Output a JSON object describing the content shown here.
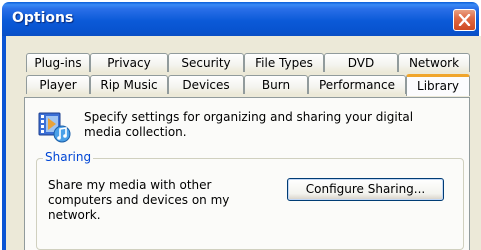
{
  "window": {
    "title": "Options",
    "close_icon": "close-icon"
  },
  "tabs": {
    "row_top": [
      "Plug-ins",
      "Privacy",
      "Security",
      "File Types",
      "DVD",
      "Network"
    ],
    "row_bottom": [
      "Player",
      "Rip Music",
      "Devices",
      "Burn",
      "Performance",
      "Library"
    ],
    "active": "Library"
  },
  "library": {
    "icon": "media-library-icon",
    "description": "Specify settings for organizing and sharing your digital media collection.",
    "sharing": {
      "group_label": "Sharing",
      "text": "Share my media with other computers and devices on my network.",
      "button_label": "Configure Sharing..."
    }
  },
  "colors": {
    "titlebar": "#0a5ed9",
    "close_button": "#e06a45",
    "active_tab_accent": "#f0a52c",
    "group_label": "#0046d5",
    "dialog_face": "#ece9d8"
  }
}
